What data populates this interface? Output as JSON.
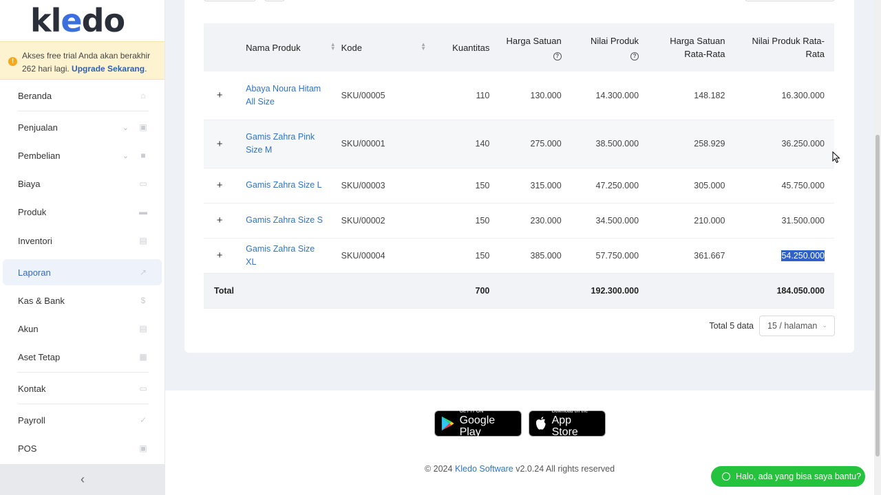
{
  "logo": {
    "text_pre": "kl",
    "text_e": "e",
    "text_post": "do"
  },
  "trial_banner": {
    "text": "Akses free trial Anda akan berakhir 262 hari lagi. ",
    "link": "Upgrade Sekarang",
    "suffix": "."
  },
  "sidebar": {
    "items": [
      {
        "label": "Beranda",
        "icon": "home-icon"
      },
      {
        "label": "Penjualan",
        "icon": "basket-icon",
        "has_chevron": true
      },
      {
        "label": "Pembelian",
        "icon": "bag-icon",
        "has_chevron": true
      },
      {
        "label": "Biaya",
        "icon": "card-icon"
      },
      {
        "label": "Produk",
        "icon": "box-icon"
      },
      {
        "label": "Inventori",
        "icon": "inventory-icon"
      },
      {
        "label": "Laporan",
        "icon": "chart-icon",
        "active": true
      },
      {
        "label": "Kas & Bank",
        "icon": "dollar-icon"
      },
      {
        "label": "Akun",
        "icon": "list-icon"
      },
      {
        "label": "Aset Tetap",
        "icon": "building-icon"
      },
      {
        "label": "Kontak",
        "icon": "contact-icon"
      },
      {
        "label": "Payroll",
        "icon": "check-circle-icon"
      },
      {
        "label": "POS",
        "icon": "pos-icon"
      }
    ],
    "collapse_glyph": "‹"
  },
  "table": {
    "headers": {
      "nama": "Nama Produk",
      "kode": "Kode",
      "kuantitas": "Kuantitas",
      "harga_satuan": "Harga Satuan",
      "nilai_produk": "Nilai Produk",
      "harga_rata": "Harga Satuan Rata-Rata",
      "nilai_rata": "Nilai Produk Rata-Rata"
    },
    "rows": [
      {
        "nama": "Abaya Noura Hitam All Size",
        "kode": "SKU/00005",
        "kuantitas": "110",
        "harga_satuan": "130.000",
        "nilai_produk": "14.300.000",
        "harga_rata": "148.182",
        "nilai_rata": "16.300.000"
      },
      {
        "nama": "Gamis Zahra Pink Size M",
        "kode": "SKU/00001",
        "kuantitas": "140",
        "harga_satuan": "275.000",
        "nilai_produk": "38.500.000",
        "harga_rata": "258.929",
        "nilai_rata": "36.250.000"
      },
      {
        "nama": "Gamis Zahra Size L",
        "kode": "SKU/00003",
        "kuantitas": "150",
        "harga_satuan": "315.000",
        "nilai_produk": "47.250.000",
        "harga_rata": "305.000",
        "nilai_rata": "45.750.000"
      },
      {
        "nama": "Gamis Zahra Size S",
        "kode": "SKU/00002",
        "kuantitas": "150",
        "harga_satuan": "230.000",
        "nilai_produk": "34.500.000",
        "harga_rata": "210.000",
        "nilai_rata": "31.500.000"
      },
      {
        "nama": "Gamis Zahra Size XL",
        "kode": "SKU/00004",
        "kuantitas": "150",
        "harga_satuan": "385.000",
        "nilai_produk": "57.750.000",
        "harga_rata": "361.667",
        "nilai_rata": "54.250.000"
      }
    ],
    "total": {
      "label": "Total",
      "kuantitas": "700",
      "nilai_produk": "192.300.000",
      "nilai_rata": "184.050.000"
    },
    "expand_glyph": "+"
  },
  "pagination": {
    "total_label": "Total 5 data",
    "page_size": "15 / halaman"
  },
  "footer": {
    "google_play_small": "GET IT ON",
    "google_play_big": "Google Play",
    "app_store_small": "Download on the",
    "app_store_big": "App Store",
    "copyright_pre": "© 2024 ",
    "copyright_brand": "Kledo Software",
    "copyright_post": " v2.0.24 All rights reserved"
  },
  "chat": {
    "label": "Halo, ada yang bisa saya bantu?"
  },
  "colors": {
    "accent": "#2e74c8",
    "chat_green": "#25c23e",
    "banner": "#fdf3d1"
  }
}
